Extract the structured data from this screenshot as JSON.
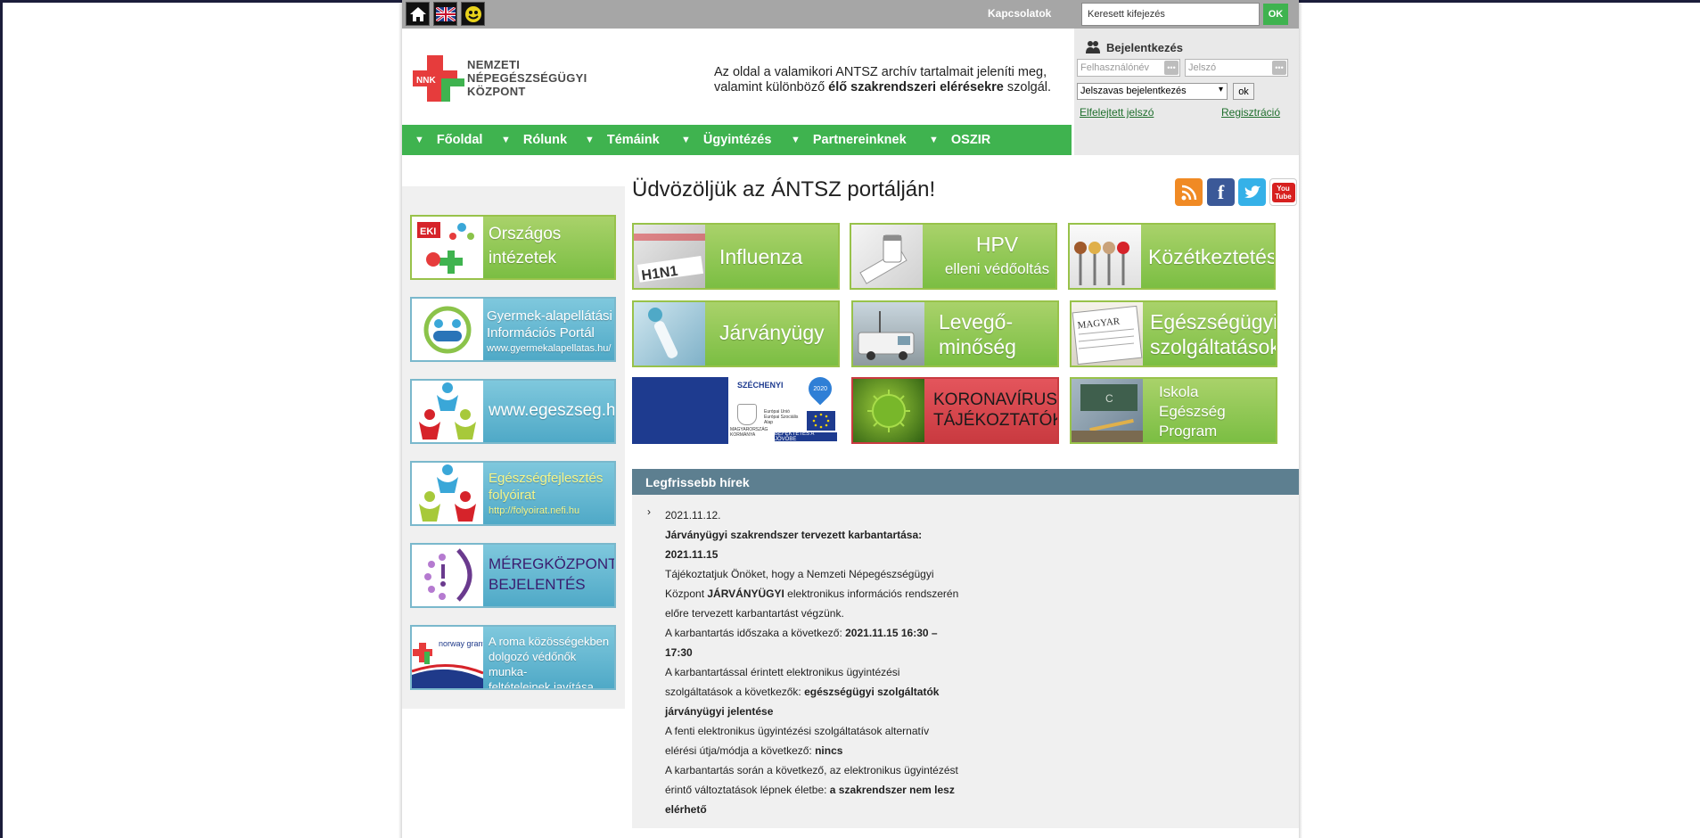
{
  "topbar": {
    "icons": [
      "home-icon",
      "uk-flag-icon",
      "accessibility-icon"
    ],
    "contacts_link": "Kapcsolatok",
    "search_placeholder": "Keresett kifejezés",
    "search_button": "OK"
  },
  "header": {
    "logo_badge": "NNK",
    "logo_lines": [
      "NEMZETI",
      "NÉPEGÉSZSÉGÜGYI",
      "KÖZPONT"
    ],
    "tagline_1": "Az oldal a valamikori ANTSZ archív tartalmait jeleníti meg,",
    "tagline_2_pre": "valamint különböző ",
    "tagline_2_bold": "élő szakrendszeri elérésekre",
    "tagline_2_post": " szolgál."
  },
  "login": {
    "title": "Bejelentkezés",
    "username_placeholder": "Felhasználónév",
    "password_placeholder": "Jelszó",
    "method_selected": "Jelszavas bejelentkezés",
    "ok_button": "ok",
    "forgot_link": "Elfelejtett jelszó",
    "register_link": "Regisztráció"
  },
  "nav": {
    "items": [
      "Főoldal",
      "Rólunk",
      "Témáink",
      "Ügyintézés",
      "Partnereinknek",
      "OSZIR"
    ]
  },
  "sidebar": {
    "tiles": [
      {
        "line1": "Országos",
        "line2": "intézetek"
      },
      {
        "line1": "Gyermek-alapellátási",
        "line2": "Információs Portál",
        "url": "www.gyermekalapellatas.hu/"
      },
      {
        "line1": "www.egeszseg.hu"
      },
      {
        "line1": "Egészségfejlesztés",
        "line2": "folyóirat",
        "url": "http://folyoirat.nefi.hu"
      },
      {
        "line1": "MÉREGKÖZPONTI",
        "line2": "BEJELENTÉS"
      },
      {
        "line1": "A roma közösségekben",
        "line2": "dolgozó védőnők munka-",
        "line3": "feltételeinek javítása",
        "badge": "norway grants"
      }
    ]
  },
  "main": {
    "welcome": "Üdvözöljük az ÁNTSZ portálján!",
    "social_icons": [
      "rss-icon",
      "facebook-icon",
      "twitter-icon",
      "youtube-icon"
    ],
    "youtube_text": "You Tube",
    "tiles": [
      {
        "line1": "Influenza"
      },
      {
        "line1": "HPV",
        "line2": "elleni védőoltás"
      },
      {
        "line1": "Közétkeztetés"
      },
      {
        "line1": "Járványügy"
      },
      {
        "line1": "Levegő-",
        "line2": "minőség"
      },
      {
        "line1": "Egészségügyi",
        "line2": "szolgáltatások"
      },
      {
        "line1": "SZÉCHENYI",
        "badge": "2020",
        "eu_text": "Európai Unió Európai Szociális Alap",
        "gov_text": "MAGYARORSZÁG KORMÁNYA",
        "slogan": "BEFEKTETÉS A JÖVŐBE"
      },
      {
        "line1": "KORONAVÍRUS",
        "line2": "TÁJÉKOZTATÓK"
      },
      {
        "line1": "Iskola",
        "line2": "Egészség",
        "line3": "Program"
      }
    ]
  },
  "news": {
    "header": "Legfrissebb hírek",
    "date": "2021.11.12.",
    "title": "Járványügyi szakrendszer tervezett karbantartása:",
    "title_date": "2021.11.15",
    "p1_pre": "Tájékoztatjuk Önöket, hogy a Nemzeti Népegészségügyi Központ ",
    "p1_bold": "JÁRVÁNYÜGYI",
    "p1_post": " elektronikus információs rendszerén előre tervezett karbantartást végzünk.",
    "p2_pre": "A karbantartás időszaka a következő: ",
    "p2_bold": "2021.11.15  16:30 – 17:30",
    "p3_pre": "A karbantartással érintett elektronikus ügyintézési szolgáltatások a következők: ",
    "p3_bold": "egészségügyi szolgáltatók járványügyi jelentése",
    "p4_pre": "A fenti elektronikus ügyintézési szolgáltatások alternatív elérési útja/módja a következő: ",
    "p4_bold": "nincs",
    "p5_pre": "A karbantartás során a következő, az elektronikus ügyintézést érintő változtatások lépnek életbe: ",
    "p5_bold": "a szakrendszer nem lesz elérhető"
  },
  "colors": {
    "green": "#3fb34f",
    "tile_green": "#7bbe43",
    "tile_blue": "#5aafc9",
    "news_header": "#5d7f90",
    "corona_red": "#d8434a"
  }
}
